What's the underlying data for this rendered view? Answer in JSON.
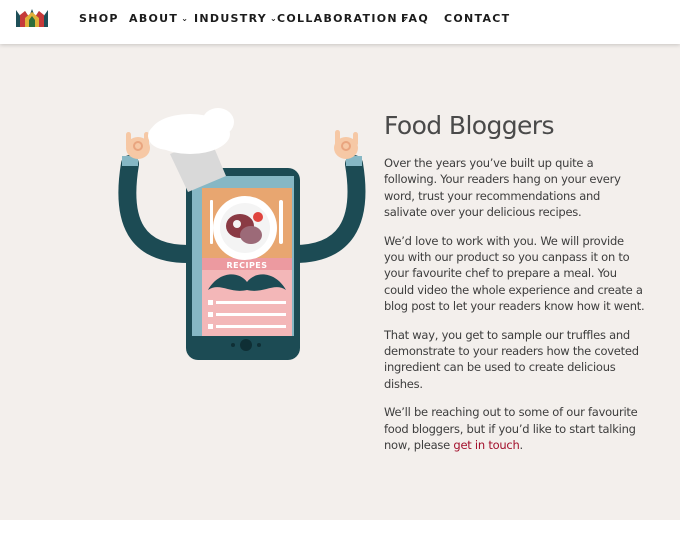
{
  "nav": {
    "items": [
      {
        "label": "SHOP",
        "has_dropdown": false
      },
      {
        "label": "ABOUT",
        "has_dropdown": true
      },
      {
        "label": "INDUSTRY",
        "has_dropdown": true
      },
      {
        "label": "COLLABORATION",
        "has_dropdown": true
      },
      {
        "label": "FAQ",
        "has_dropdown": false
      },
      {
        "label": "CONTACT",
        "has_dropdown": false
      }
    ],
    "dropdown_icon": "chevron-down-icon"
  },
  "illustration": {
    "screen_label": "RECIPES"
  },
  "main": {
    "title": "Food Bloggers",
    "paragraphs": [
      "Over the years you’ve built up quite a following. Your readers hang on your every word, trust your recommendations and salivate over your delicious recipes.",
      "We’d love to work with you. We will provide you with our product so you canpass it on to your favourite chef to prepare a meal. You could video the whole experience and create a blog post to let your readers know how it went.",
      "That way, you get to sample our truffles and demonstrate to your readers how the coveted ingredient can be used to create delicious dishes."
    ],
    "last_paragraph": {
      "text": "We’ll be reaching out to some of our favourite food bloggers, but if you’d like to start talking now, please ",
      "link_text": "get in touch",
      "end": "."
    }
  },
  "colors": {
    "background": "#f3efec",
    "link": "#a3102c",
    "phone_dark": "#1c4b54",
    "screen_teal": "#86b7c4",
    "screen_orange": "#e8a670",
    "screen_pink": "#f3b7b8"
  }
}
